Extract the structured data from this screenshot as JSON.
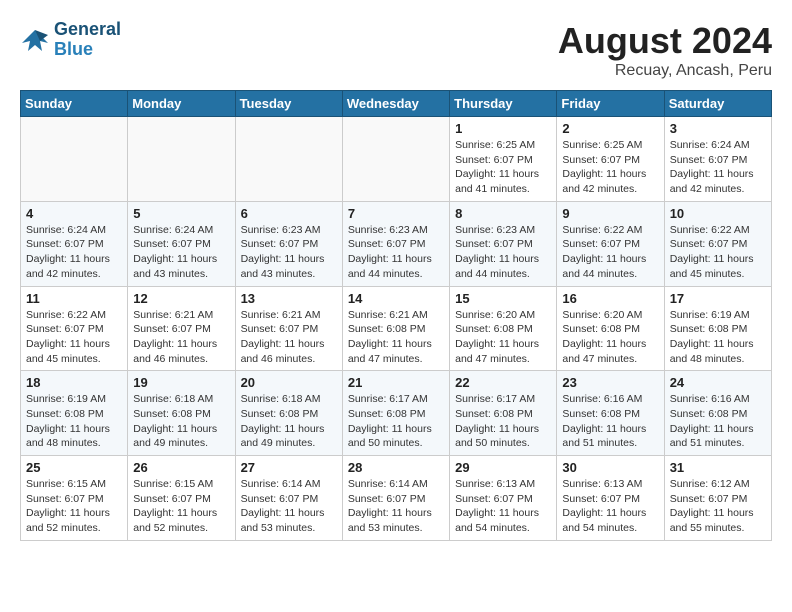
{
  "header": {
    "logo_line1": "General",
    "logo_line2": "Blue",
    "title": "August 2024",
    "subtitle": "Recuay, Ancash, Peru"
  },
  "days_of_week": [
    "Sunday",
    "Monday",
    "Tuesday",
    "Wednesday",
    "Thursday",
    "Friday",
    "Saturday"
  ],
  "weeks": [
    [
      {
        "day": "",
        "info": ""
      },
      {
        "day": "",
        "info": ""
      },
      {
        "day": "",
        "info": ""
      },
      {
        "day": "",
        "info": ""
      },
      {
        "day": "1",
        "info": "Sunrise: 6:25 AM\nSunset: 6:07 PM\nDaylight: 11 hours\nand 41 minutes."
      },
      {
        "day": "2",
        "info": "Sunrise: 6:25 AM\nSunset: 6:07 PM\nDaylight: 11 hours\nand 42 minutes."
      },
      {
        "day": "3",
        "info": "Sunrise: 6:24 AM\nSunset: 6:07 PM\nDaylight: 11 hours\nand 42 minutes."
      }
    ],
    [
      {
        "day": "4",
        "info": "Sunrise: 6:24 AM\nSunset: 6:07 PM\nDaylight: 11 hours\nand 42 minutes."
      },
      {
        "day": "5",
        "info": "Sunrise: 6:24 AM\nSunset: 6:07 PM\nDaylight: 11 hours\nand 43 minutes."
      },
      {
        "day": "6",
        "info": "Sunrise: 6:23 AM\nSunset: 6:07 PM\nDaylight: 11 hours\nand 43 minutes."
      },
      {
        "day": "7",
        "info": "Sunrise: 6:23 AM\nSunset: 6:07 PM\nDaylight: 11 hours\nand 44 minutes."
      },
      {
        "day": "8",
        "info": "Sunrise: 6:23 AM\nSunset: 6:07 PM\nDaylight: 11 hours\nand 44 minutes."
      },
      {
        "day": "9",
        "info": "Sunrise: 6:22 AM\nSunset: 6:07 PM\nDaylight: 11 hours\nand 44 minutes."
      },
      {
        "day": "10",
        "info": "Sunrise: 6:22 AM\nSunset: 6:07 PM\nDaylight: 11 hours\nand 45 minutes."
      }
    ],
    [
      {
        "day": "11",
        "info": "Sunrise: 6:22 AM\nSunset: 6:07 PM\nDaylight: 11 hours\nand 45 minutes."
      },
      {
        "day": "12",
        "info": "Sunrise: 6:21 AM\nSunset: 6:07 PM\nDaylight: 11 hours\nand 46 minutes."
      },
      {
        "day": "13",
        "info": "Sunrise: 6:21 AM\nSunset: 6:07 PM\nDaylight: 11 hours\nand 46 minutes."
      },
      {
        "day": "14",
        "info": "Sunrise: 6:21 AM\nSunset: 6:08 PM\nDaylight: 11 hours\nand 47 minutes."
      },
      {
        "day": "15",
        "info": "Sunrise: 6:20 AM\nSunset: 6:08 PM\nDaylight: 11 hours\nand 47 minutes."
      },
      {
        "day": "16",
        "info": "Sunrise: 6:20 AM\nSunset: 6:08 PM\nDaylight: 11 hours\nand 47 minutes."
      },
      {
        "day": "17",
        "info": "Sunrise: 6:19 AM\nSunset: 6:08 PM\nDaylight: 11 hours\nand 48 minutes."
      }
    ],
    [
      {
        "day": "18",
        "info": "Sunrise: 6:19 AM\nSunset: 6:08 PM\nDaylight: 11 hours\nand 48 minutes."
      },
      {
        "day": "19",
        "info": "Sunrise: 6:18 AM\nSunset: 6:08 PM\nDaylight: 11 hours\nand 49 minutes."
      },
      {
        "day": "20",
        "info": "Sunrise: 6:18 AM\nSunset: 6:08 PM\nDaylight: 11 hours\nand 49 minutes."
      },
      {
        "day": "21",
        "info": "Sunrise: 6:17 AM\nSunset: 6:08 PM\nDaylight: 11 hours\nand 50 minutes."
      },
      {
        "day": "22",
        "info": "Sunrise: 6:17 AM\nSunset: 6:08 PM\nDaylight: 11 hours\nand 50 minutes."
      },
      {
        "day": "23",
        "info": "Sunrise: 6:16 AM\nSunset: 6:08 PM\nDaylight: 11 hours\nand 51 minutes."
      },
      {
        "day": "24",
        "info": "Sunrise: 6:16 AM\nSunset: 6:08 PM\nDaylight: 11 hours\nand 51 minutes."
      }
    ],
    [
      {
        "day": "25",
        "info": "Sunrise: 6:15 AM\nSunset: 6:07 PM\nDaylight: 11 hours\nand 52 minutes."
      },
      {
        "day": "26",
        "info": "Sunrise: 6:15 AM\nSunset: 6:07 PM\nDaylight: 11 hours\nand 52 minutes."
      },
      {
        "day": "27",
        "info": "Sunrise: 6:14 AM\nSunset: 6:07 PM\nDaylight: 11 hours\nand 53 minutes."
      },
      {
        "day": "28",
        "info": "Sunrise: 6:14 AM\nSunset: 6:07 PM\nDaylight: 11 hours\nand 53 minutes."
      },
      {
        "day": "29",
        "info": "Sunrise: 6:13 AM\nSunset: 6:07 PM\nDaylight: 11 hours\nand 54 minutes."
      },
      {
        "day": "30",
        "info": "Sunrise: 6:13 AM\nSunset: 6:07 PM\nDaylight: 11 hours\nand 54 minutes."
      },
      {
        "day": "31",
        "info": "Sunrise: 6:12 AM\nSunset: 6:07 PM\nDaylight: 11 hours\nand 55 minutes."
      }
    ]
  ]
}
